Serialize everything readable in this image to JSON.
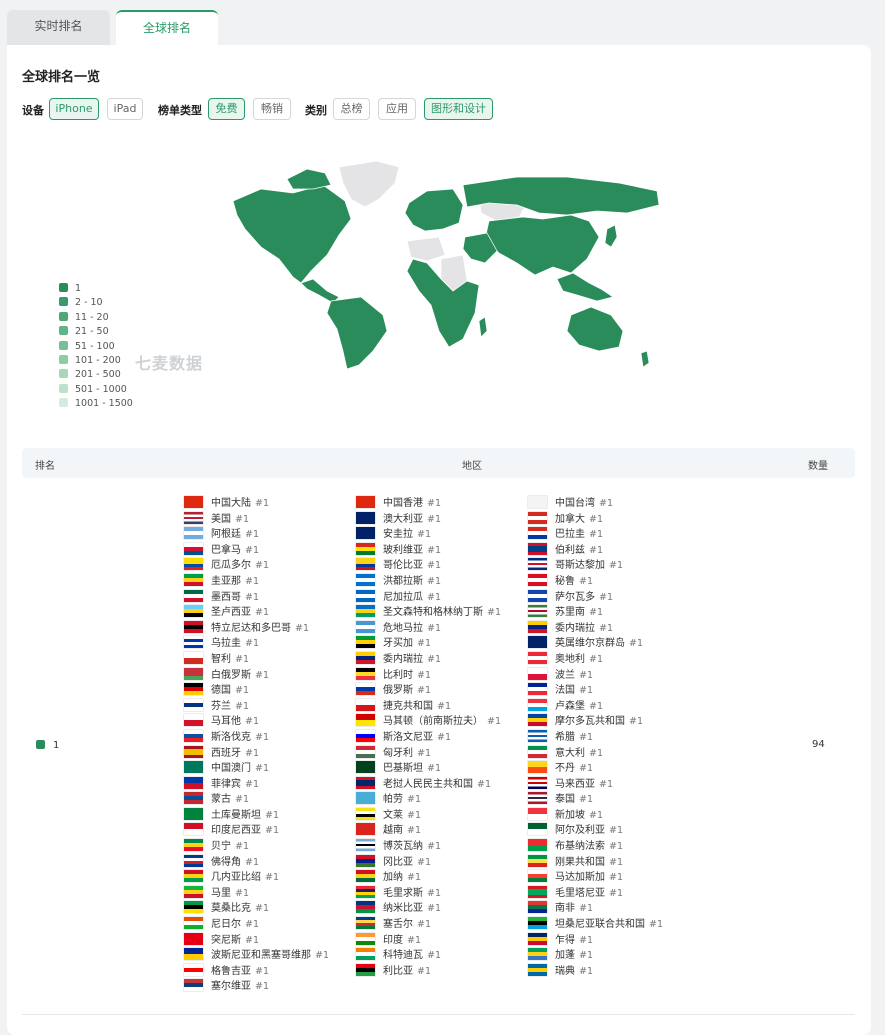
{
  "tabs": [
    "实时排名",
    "全球排名"
  ],
  "section_title": "全球排名一览",
  "filters": {
    "device_label": "设备",
    "device_options": [
      "iPhone",
      "iPad"
    ],
    "chart_type_label": "榜单类型",
    "chart_type_options": [
      "免费",
      "畅销"
    ],
    "category_label": "类别",
    "category_options": [
      "总榜",
      "应用",
      "图形和设计"
    ],
    "selected": {
      "device": "iPhone",
      "chart_type": "免费",
      "category": "图形和设计"
    }
  },
  "map": {
    "watermark": "七麦数据",
    "legend": [
      "1",
      "2 - 10",
      "11 - 20",
      "21 - 50",
      "51 - 100",
      "101 - 200",
      "201 - 500",
      "501 - 1000",
      "1001 - 1500"
    ],
    "legend_colors": [
      "#2a8c5a",
      "#3a9a68",
      "#4ea776",
      "#62b387",
      "#78bf97",
      "#8ecba8",
      "#a6d7b9",
      "#bde2cc",
      "#d3ecdd"
    ],
    "ranked_color": "#2a8c5a",
    "unranked_color": "#e4e4e6"
  },
  "table": {
    "headers": {
      "rank": "排名",
      "region": "地区",
      "count": "数量"
    },
    "row": {
      "rank": "1",
      "count": "94",
      "rank_tag": "#1",
      "columns": [
        [
          {
            "name": "中国大陆",
            "flag": [
              "#de2910"
            ]
          },
          {
            "name": "美国",
            "flag": [
              "#b22234",
              "#ffffff",
              "#b22234",
              "#ffffff",
              "#3c3b6e"
            ]
          },
          {
            "name": "阿根廷",
            "flag": [
              "#74acdf",
              "#ffffff",
              "#74acdf"
            ]
          },
          {
            "name": "巴拿马",
            "flag": [
              "#ffffff",
              "#d21034",
              "#005293"
            ]
          },
          {
            "name": "厄瓜多尔",
            "flag": [
              "#ffdd00",
              "#ffdd00",
              "#034ea2",
              "#ed1c24"
            ]
          },
          {
            "name": "圭亚那",
            "flag": [
              "#009e49",
              "#fcd116",
              "#ce1126"
            ]
          },
          {
            "name": "墨西哥",
            "flag": [
              "#006847",
              "#ffffff",
              "#ce1126"
            ]
          },
          {
            "name": "圣卢西亚",
            "flag": [
              "#65cfff",
              "#fcd116",
              "#000000"
            ]
          },
          {
            "name": "特立尼达和多巴哥",
            "flag": [
              "#ce1126",
              "#000000",
              "#ce1126"
            ]
          },
          {
            "name": "乌拉圭",
            "flag": [
              "#ffffff",
              "#0038a8",
              "#ffffff",
              "#0038a8"
            ]
          },
          {
            "name": "智利",
            "flag": [
              "#ffffff",
              "#d52b1e"
            ]
          },
          {
            "name": "白俄罗斯",
            "flag": [
              "#c8313e",
              "#c8313e",
              "#4aa657"
            ]
          },
          {
            "name": "德国",
            "flag": [
              "#000000",
              "#dd0000",
              "#ffce00"
            ]
          },
          {
            "name": "芬兰",
            "flag": [
              "#ffffff",
              "#003580",
              "#ffffff"
            ]
          },
          {
            "name": "马耳他",
            "flag": [
              "#ffffff",
              "#cf142b"
            ]
          },
          {
            "name": "斯洛伐克",
            "flag": [
              "#ffffff",
              "#0b4ea2",
              "#ee1c25"
            ]
          },
          {
            "name": "西班牙",
            "flag": [
              "#aa151b",
              "#f1bf00",
              "#f1bf00",
              "#aa151b"
            ]
          },
          {
            "name": "中国澳门",
            "flag": [
              "#00785e"
            ]
          },
          {
            "name": "菲律宾",
            "flag": [
              "#0038a8",
              "#ce1126"
            ]
          },
          {
            "name": "蒙古",
            "flag": [
              "#c4272f",
              "#015197",
              "#c4272f"
            ]
          },
          {
            "name": "土库曼斯坦",
            "flag": [
              "#00843d"
            ]
          },
          {
            "name": "印度尼西亚",
            "flag": [
              "#ce1126",
              "#ffffff"
            ]
          },
          {
            "name": "贝宁",
            "flag": [
              "#008751",
              "#fcd116",
              "#e8112d"
            ]
          },
          {
            "name": "佛得角",
            "flag": [
              "#003893",
              "#ffffff",
              "#cf2027",
              "#003893"
            ]
          },
          {
            "name": "几内亚比绍",
            "flag": [
              "#ce1126",
              "#fcd116",
              "#009e49"
            ]
          },
          {
            "name": "马里",
            "flag": [
              "#14b53a",
              "#fcd116",
              "#ce1126"
            ]
          },
          {
            "name": "莫桑比克",
            "flag": [
              "#009a44",
              "#000000",
              "#fce100"
            ]
          },
          {
            "name": "尼日尔",
            "flag": [
              "#e05206",
              "#ffffff",
              "#0db02b"
            ]
          },
          {
            "name": "突尼斯",
            "flag": [
              "#e70013"
            ]
          },
          {
            "name": "波斯尼亚和黑塞哥维那",
            "flag": [
              "#002395",
              "#fecb00"
            ]
          },
          {
            "name": "格鲁吉亚",
            "flag": [
              "#ffffff",
              "#ff0000",
              "#ffffff"
            ]
          },
          {
            "name": "塞尔维亚",
            "flag": [
              "#c6363c",
              "#0c4076",
              "#ffffff"
            ]
          }
        ],
        [
          {
            "name": "中国香港",
            "flag": [
              "#de2910"
            ]
          },
          {
            "name": "澳大利亚",
            "flag": [
              "#012169"
            ]
          },
          {
            "name": "安圭拉",
            "flag": [
              "#012169"
            ]
          },
          {
            "name": "玻利维亚",
            "flag": [
              "#d52b1e",
              "#f9e300",
              "#007934"
            ]
          },
          {
            "name": "哥伦比亚",
            "flag": [
              "#fcd116",
              "#fcd116",
              "#003893",
              "#ce1126"
            ]
          },
          {
            "name": "洪都拉斯",
            "flag": [
              "#0073cf",
              "#ffffff",
              "#0073cf"
            ]
          },
          {
            "name": "尼加拉瓜",
            "flag": [
              "#0067c6",
              "#ffffff",
              "#0067c6"
            ]
          },
          {
            "name": "圣文森特和格林纳丁斯",
            "flag": [
              "#0072c6",
              "#fcd116",
              "#009e60"
            ]
          },
          {
            "name": "危地马拉",
            "flag": [
              "#4997d0",
              "#ffffff",
              "#4997d0"
            ]
          },
          {
            "name": "牙买加",
            "flag": [
              "#009b3a",
              "#fed100",
              "#000000"
            ]
          },
          {
            "name": "委内瑞拉",
            "flag": [
              "#ffcc00",
              "#00247d",
              "#cf142b"
            ]
          },
          {
            "name": "比利时",
            "flag": [
              "#000000",
              "#fdda24",
              "#ef3340"
            ]
          },
          {
            "name": "俄罗斯",
            "flag": [
              "#ffffff",
              "#0039a6",
              "#d52b1e"
            ]
          },
          {
            "name": "捷克共和国",
            "flag": [
              "#ffffff",
              "#d7141a"
            ]
          },
          {
            "name": "马其顿（前南斯拉夫）",
            "flag": [
              "#d20000",
              "#ffe600"
            ]
          },
          {
            "name": "斯洛文尼亚",
            "flag": [
              "#ffffff",
              "#0000ff",
              "#ff0000"
            ]
          },
          {
            "name": "匈牙利",
            "flag": [
              "#ce2939",
              "#ffffff",
              "#477050"
            ]
          },
          {
            "name": "巴基斯坦",
            "flag": [
              "#01411c"
            ]
          },
          {
            "name": "老挝人民民主共和国",
            "flag": [
              "#ce1126",
              "#002868",
              "#002868",
              "#ce1126"
            ]
          },
          {
            "name": "帕劳",
            "flag": [
              "#4aadd6"
            ]
          },
          {
            "name": "文莱",
            "flag": [
              "#f7e017",
              "#ffffff",
              "#000000",
              "#f7e017"
            ]
          },
          {
            "name": "越南",
            "flag": [
              "#da251d"
            ]
          },
          {
            "name": "博茨瓦纳",
            "flag": [
              "#75aadb",
              "#ffffff",
              "#000000",
              "#ffffff",
              "#75aadb"
            ]
          },
          {
            "name": "冈比亚",
            "flag": [
              "#ce1126",
              "#0c1c8c",
              "#3a7728"
            ]
          },
          {
            "name": "加纳",
            "flag": [
              "#ce1126",
              "#fcd116",
              "#006b3f"
            ]
          },
          {
            "name": "毛里求斯",
            "flag": [
              "#ea2839",
              "#1a206d",
              "#ffd500",
              "#00a551"
            ]
          },
          {
            "name": "纳米比亚",
            "flag": [
              "#003580",
              "#d21034",
              "#009543"
            ]
          },
          {
            "name": "塞舌尔",
            "flag": [
              "#003f87",
              "#fcd856",
              "#d62828",
              "#007a3d"
            ]
          },
          {
            "name": "印度",
            "flag": [
              "#ff9933",
              "#ffffff",
              "#138808"
            ]
          },
          {
            "name": "科特迪瓦",
            "flag": [
              "#f77f00",
              "#ffffff",
              "#009e60"
            ]
          },
          {
            "name": "利比亚",
            "flag": [
              "#e70013",
              "#000000",
              "#239e46"
            ]
          }
        ],
        [
          {
            "name": "中国台湾",
            "flag": [
              "#f4f4f4"
            ]
          },
          {
            "name": "加拿大",
            "flag": [
              "#d52b1e",
              "#ffffff",
              "#d52b1e"
            ]
          },
          {
            "name": "巴拉圭",
            "flag": [
              "#d52b1e",
              "#ffffff",
              "#0038a8"
            ]
          },
          {
            "name": "伯利兹",
            "flag": [
              "#ce1126",
              "#003f87",
              "#003f87",
              "#ce1126"
            ]
          },
          {
            "name": "哥斯达黎加",
            "flag": [
              "#002b7f",
              "#ffffff",
              "#ce1126",
              "#ffffff",
              "#002b7f"
            ]
          },
          {
            "name": "秘鲁",
            "flag": [
              "#d91023",
              "#ffffff",
              "#d91023"
            ]
          },
          {
            "name": "萨尔瓦多",
            "flag": [
              "#0f47af",
              "#ffffff",
              "#0f47af"
            ]
          },
          {
            "name": "苏里南",
            "flag": [
              "#377e3f",
              "#ffffff",
              "#b40a2d",
              "#ffffff",
              "#377e3f"
            ]
          },
          {
            "name": "委内瑞拉",
            "flag": [
              "#ffcc00",
              "#00247d",
              "#cf142b"
            ]
          },
          {
            "name": "英属维尔京群岛",
            "flag": [
              "#012169"
            ]
          },
          {
            "name": "奥地利",
            "flag": [
              "#ed2939",
              "#ffffff",
              "#ed2939"
            ]
          },
          {
            "name": "波兰",
            "flag": [
              "#ffffff",
              "#dc143c"
            ]
          },
          {
            "name": "法国",
            "flag": [
              "#002395",
              "#ffffff",
              "#ed2939"
            ]
          },
          {
            "name": "卢森堡",
            "flag": [
              "#ef3340",
              "#ffffff",
              "#00a3e0"
            ]
          },
          {
            "name": "摩尔多瓦共和国",
            "flag": [
              "#0046ae",
              "#ffd200",
              "#cc092f"
            ]
          },
          {
            "name": "希腊",
            "flag": [
              "#0d5eaf",
              "#ffffff",
              "#0d5eaf",
              "#ffffff",
              "#0d5eaf"
            ]
          },
          {
            "name": "意大利",
            "flag": [
              "#009246",
              "#ffffff",
              "#ce2b37"
            ]
          },
          {
            "name": "不丹",
            "flag": [
              "#ffd520",
              "#ff4e12"
            ]
          },
          {
            "name": "马来西亚",
            "flag": [
              "#cc0001",
              "#ffffff",
              "#cc0001",
              "#ffffff",
              "#010066"
            ]
          },
          {
            "name": "泰国",
            "flag": [
              "#a51931",
              "#ffffff",
              "#2d2a4a",
              "#ffffff",
              "#a51931"
            ]
          },
          {
            "name": "新加坡",
            "flag": [
              "#ef3340",
              "#ffffff"
            ]
          },
          {
            "name": "阿尔及利亚",
            "flag": [
              "#006233",
              "#ffffff"
            ]
          },
          {
            "name": "布基纳法索",
            "flag": [
              "#ef2b2d",
              "#009e49"
            ]
          },
          {
            "name": "刚果共和国",
            "flag": [
              "#009543",
              "#fbde4a",
              "#dc241f"
            ]
          },
          {
            "name": "马达加斯加",
            "flag": [
              "#ffffff",
              "#fc3d32",
              "#007e3a"
            ]
          },
          {
            "name": "毛里塔尼亚",
            "flag": [
              "#d01c1f",
              "#00a95c",
              "#00a95c",
              "#d01c1f"
            ]
          },
          {
            "name": "南非",
            "flag": [
              "#de3831",
              "#007a4d",
              "#002395"
            ]
          },
          {
            "name": "坦桑尼亚联合共和国",
            "flag": [
              "#1eb53a",
              "#000000",
              "#00a3dd"
            ]
          },
          {
            "name": "乍得",
            "flag": [
              "#002664",
              "#fecb00",
              "#c60c30"
            ]
          },
          {
            "name": "加蓬",
            "flag": [
              "#009e60",
              "#fcd116",
              "#3a75c4"
            ]
          },
          {
            "name": "瑞典",
            "flag": [
              "#006aa7",
              "#fecc00",
              "#006aa7"
            ]
          }
        ]
      ]
    }
  }
}
